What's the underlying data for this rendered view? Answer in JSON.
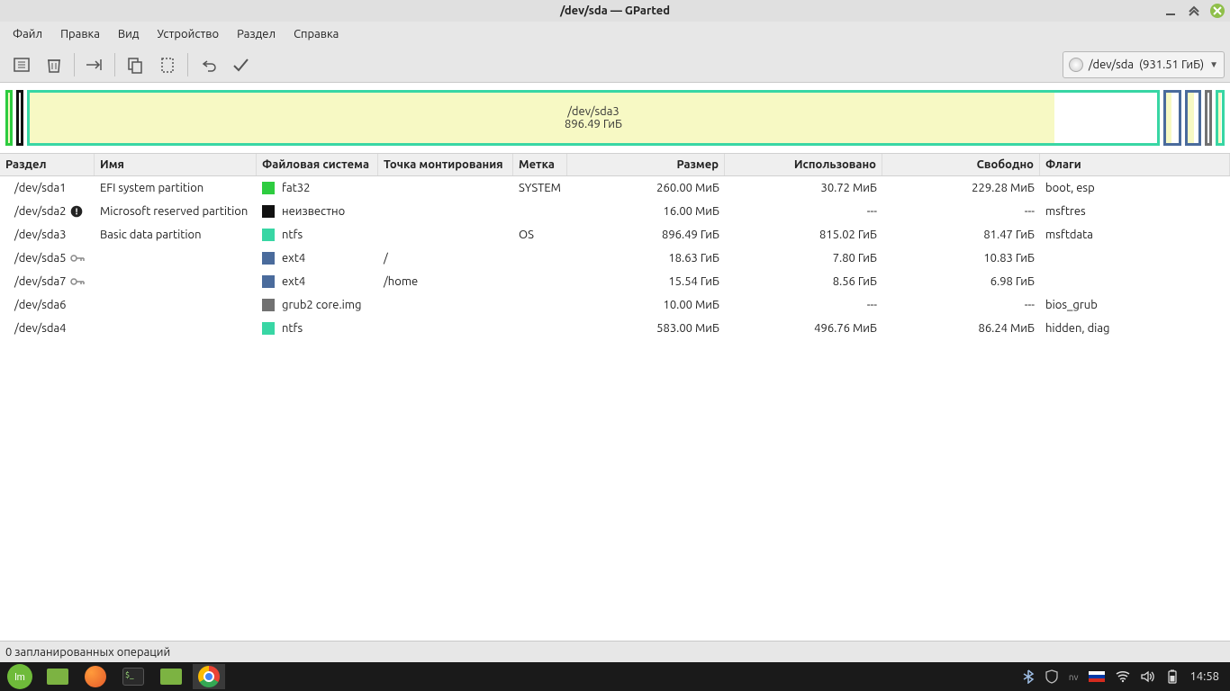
{
  "title": "/dev/sda — GParted",
  "menu": [
    "Файл",
    "Правка",
    "Вид",
    "Устройство",
    "Раздел",
    "Справка"
  ],
  "device_selector": {
    "path": "/dev/sda",
    "size": "(931.51 ГиБ)"
  },
  "diskmap": {
    "selected": {
      "device": "/dev/sda3",
      "size": "896.49 ГиБ"
    }
  },
  "columns": [
    "Раздел",
    "Имя",
    "Файловая система",
    "Точка монтирования",
    "Метка",
    "Размер",
    "Использовано",
    "Свободно",
    "Флаги"
  ],
  "partitions": [
    {
      "device": "/dev/sda1",
      "warn": false,
      "key": false,
      "name": "EFI system partition",
      "fs": "fat32",
      "fs_color": "#2ecc40",
      "mount": "",
      "label": "SYSTEM",
      "size": "260.00 МиБ",
      "used": "30.72 МиБ",
      "free": "229.28 МиБ",
      "flags": "boot, esp"
    },
    {
      "device": "/dev/sda2",
      "warn": true,
      "key": false,
      "name": "Microsoft reserved partition",
      "fs": "неизвестно",
      "fs_color": "#111111",
      "mount": "",
      "label": "",
      "size": "16.00 МиБ",
      "used": "---",
      "free": "---",
      "flags": "msftres"
    },
    {
      "device": "/dev/sda3",
      "warn": false,
      "key": false,
      "name": "Basic data partition",
      "fs": "ntfs",
      "fs_color": "#38d6a4",
      "mount": "",
      "label": "OS",
      "size": "896.49 ГиБ",
      "used": "815.02 ГиБ",
      "free": "81.47 ГиБ",
      "flags": "msftdata"
    },
    {
      "device": "/dev/sda5",
      "warn": false,
      "key": true,
      "name": "",
      "fs": "ext4",
      "fs_color": "#4a6b9c",
      "mount": "/",
      "label": "",
      "size": "18.63 ГиБ",
      "used": "7.80 ГиБ",
      "free": "10.83 ГиБ",
      "flags": ""
    },
    {
      "device": "/dev/sda7",
      "warn": false,
      "key": true,
      "name": "",
      "fs": "ext4",
      "fs_color": "#4a6b9c",
      "mount": "/home",
      "label": "",
      "size": "15.54 ГиБ",
      "used": "8.56 ГиБ",
      "free": "6.98 ГиБ",
      "flags": ""
    },
    {
      "device": "/dev/sda6",
      "warn": false,
      "key": false,
      "name": "",
      "fs": "grub2 core.img",
      "fs_color": "#717171",
      "mount": "",
      "label": "",
      "size": "10.00 МиБ",
      "used": "---",
      "free": "---",
      "flags": "bios_grub"
    },
    {
      "device": "/dev/sda4",
      "warn": false,
      "key": false,
      "name": "",
      "fs": "ntfs",
      "fs_color": "#38d6a4",
      "mount": "",
      "label": "",
      "size": "583.00 МиБ",
      "used": "496.76 МиБ",
      "free": "86.24 МиБ",
      "flags": "hidden, diag"
    }
  ],
  "statusbar": "0 запланированных операций",
  "clock": "14:58"
}
